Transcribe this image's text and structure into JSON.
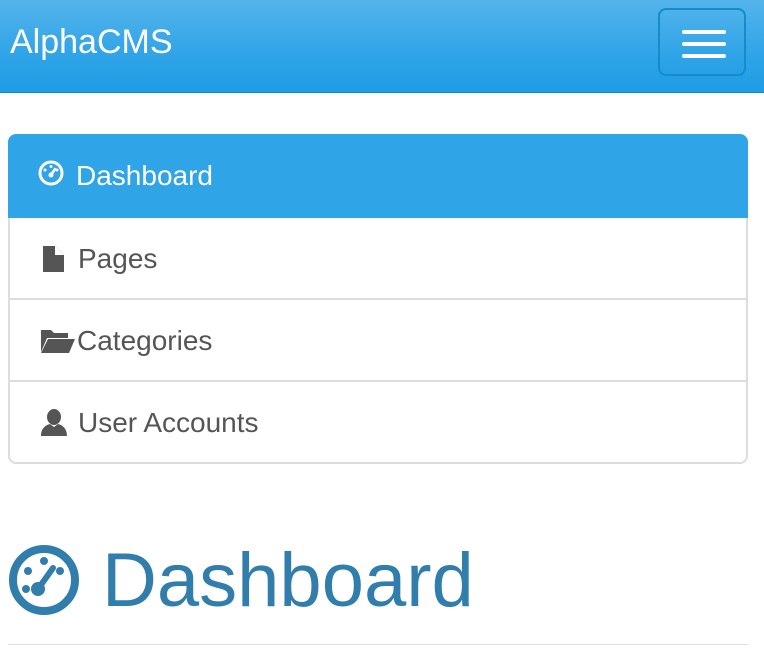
{
  "app": {
    "brand": "AlphaCMS"
  },
  "colors": {
    "primary": "#2fa4e7",
    "heading": "#317eac",
    "text": "#555555",
    "border": "#dddddd"
  },
  "navbar": {
    "toggle_icon": "hamburger-menu-icon"
  },
  "sidebar": {
    "items": [
      {
        "label": "Dashboard",
        "icon": "dashboard-icon",
        "active": true
      },
      {
        "label": "Pages",
        "icon": "file-icon",
        "active": false
      },
      {
        "label": "Categories",
        "icon": "folder-open-icon",
        "active": false
      },
      {
        "label": "User Accounts",
        "icon": "user-icon",
        "active": false
      }
    ]
  },
  "main": {
    "title": "Dashboard",
    "title_icon": "dashboard-icon"
  }
}
